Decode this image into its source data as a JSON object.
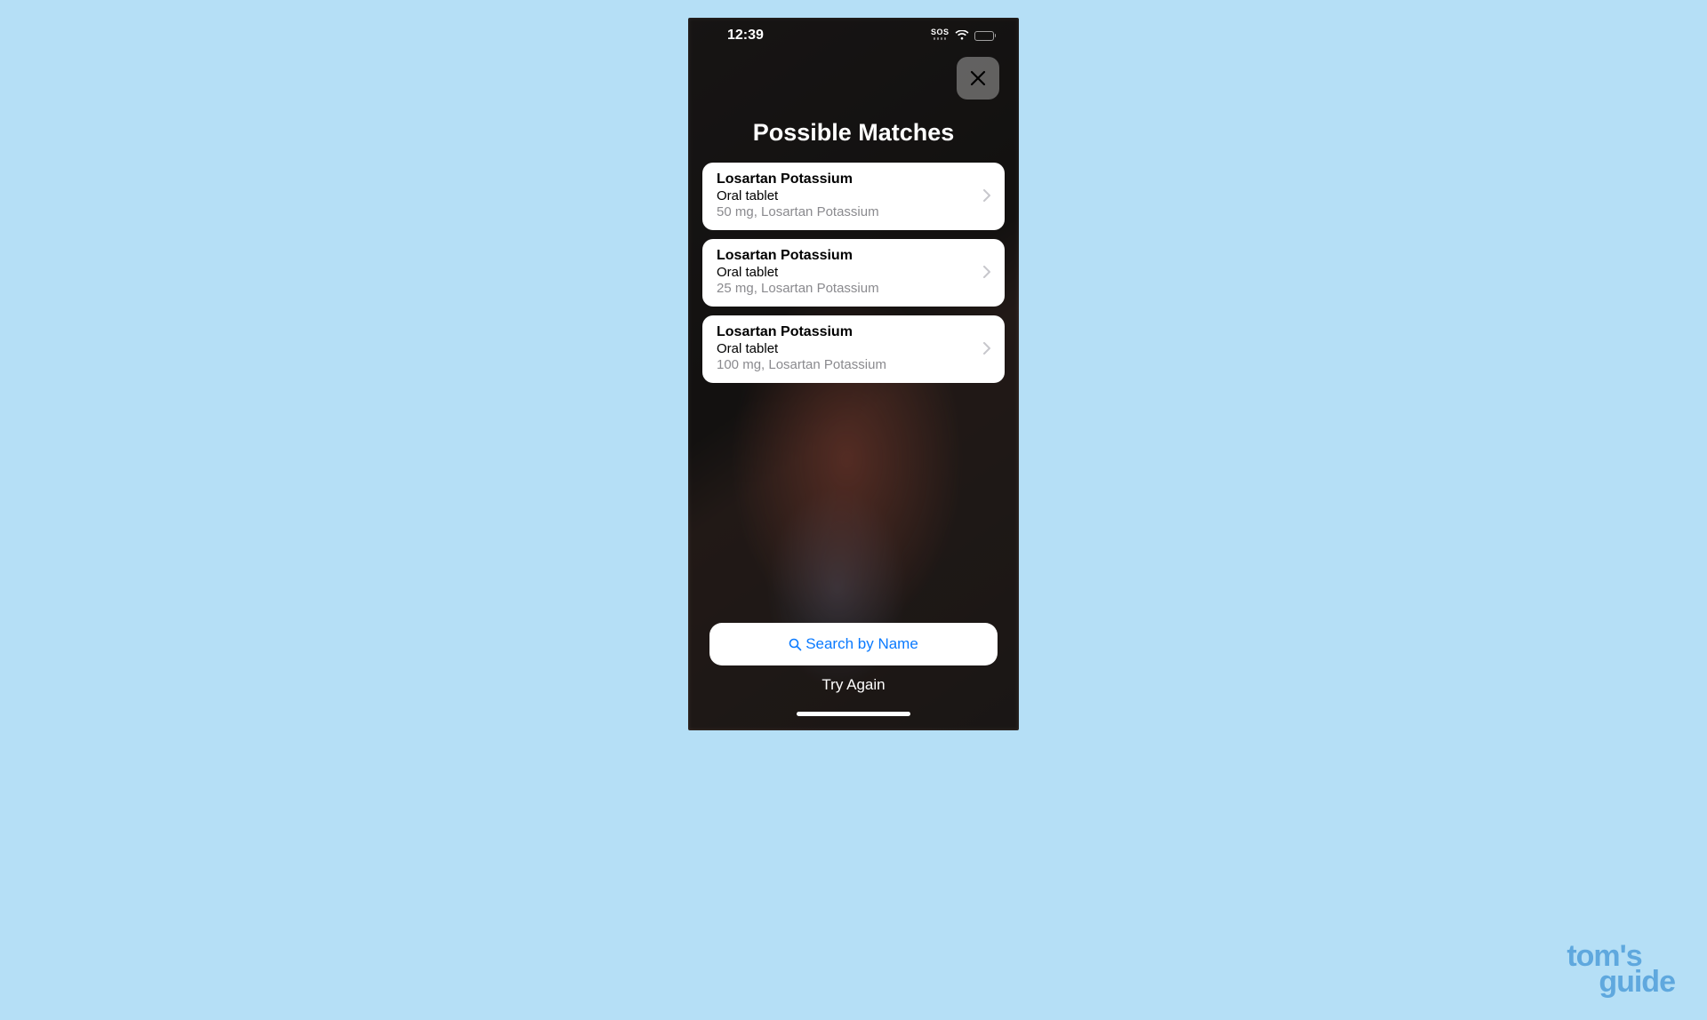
{
  "status_bar": {
    "time": "12:39",
    "sos": "SOS"
  },
  "header": {
    "title": "Possible Matches"
  },
  "matches": [
    {
      "name": "Losartan Potassium",
      "form": "Oral tablet",
      "detail": "50 mg, Losartan Potassium"
    },
    {
      "name": "Losartan Potassium",
      "form": "Oral tablet",
      "detail": "25 mg, Losartan Potassium"
    },
    {
      "name": "Losartan Potassium",
      "form": "Oral tablet",
      "detail": "100 mg, Losartan Potassium"
    }
  ],
  "actions": {
    "search_label": "Search by Name",
    "try_again": "Try Again"
  },
  "watermark": {
    "line1": "tom's",
    "line2": "guide"
  }
}
